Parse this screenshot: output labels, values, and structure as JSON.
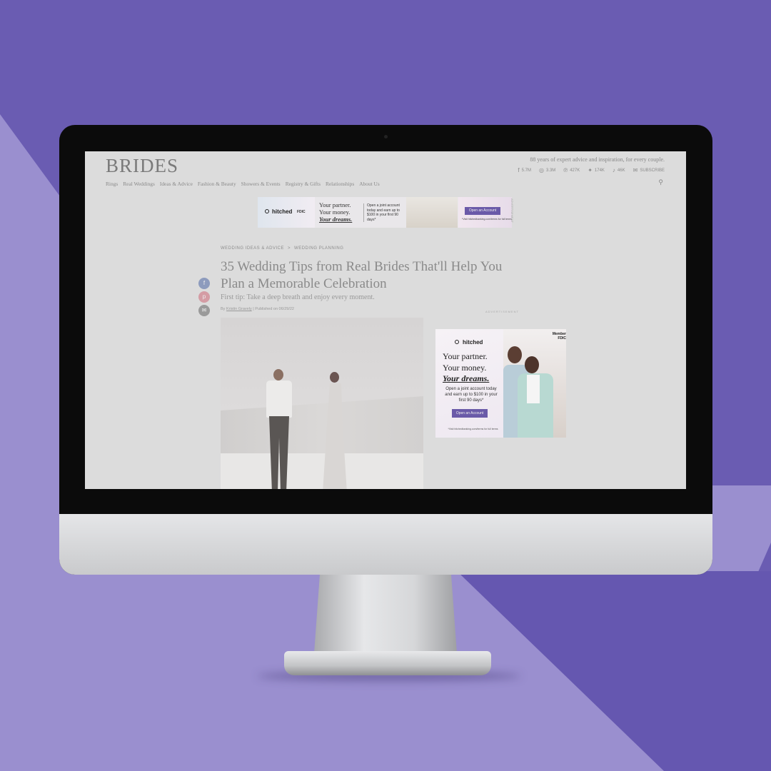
{
  "colors": {
    "background_dark": "#6a5cb2",
    "background_light": "#9a8fcf",
    "screen_bg": "#dcdcdc",
    "ad_cta": "#6a5aa8",
    "share_facebook": "#8d9bbd",
    "share_pinterest": "#d49ca4",
    "share_email": "#9a9a9a"
  },
  "site": {
    "logo": "BRIDES",
    "tagline": "88 years of expert advice and inspiration, for every couple.",
    "socials": [
      {
        "icon": "facebook-icon",
        "glyph": "f",
        "count": "5.7M"
      },
      {
        "icon": "instagram-icon",
        "glyph": "◎",
        "count": "3.3M"
      },
      {
        "icon": "pinterest-icon",
        "glyph": "℗",
        "count": "427K"
      },
      {
        "icon": "twitter-icon",
        "glyph": "✦",
        "count": "174K"
      },
      {
        "icon": "tiktok-icon",
        "glyph": "♪",
        "count": "46K"
      },
      {
        "icon": "mail-icon",
        "glyph": "✉",
        "count": "SUBSCRIBE"
      }
    ],
    "nav": [
      "Rings",
      "Real Weddings",
      "Ideas & Advice",
      "Fashion & Beauty",
      "Showers & Events",
      "Registry & Gifts",
      "Relationships",
      "About Us"
    ],
    "search_icon": "search-icon"
  },
  "top_ad": {
    "brand": "hitched",
    "fdic": "FDIC",
    "headline_1": "Your partner.",
    "headline_2": "Your money.",
    "headline_3": "Your dreams.",
    "body": "Open a joint account today and earn up to $100 in your first 90 days*",
    "cta": "Open an Account",
    "fine_print": "*Visit hitchedbanking.com/terms for full terms",
    "side_label": "ADVERTISEMENT"
  },
  "article": {
    "breadcrumb": [
      "WEDDING IDEAS & ADVICE",
      "WEDDING PLANNING"
    ],
    "breadcrumb_sep": ">",
    "title": "35 Wedding Tips from Real Brides That'll Help You Plan a Memorable Celebration",
    "subtitle": "First tip: Take a deep breath and enjoy every moment.",
    "byline_prefix": "By",
    "author": "Kristin Gravely",
    "published": "Published on 06/29/22",
    "ad_label": "ADVERTISEMENT"
  },
  "share": {
    "facebook": "f",
    "pinterest": "p",
    "email": "✉"
  },
  "side_ad": {
    "brand": "hitched",
    "fdic": "Member FDIC",
    "headline_1": "Your partner.",
    "headline_2": "Your money.",
    "headline_3": "Your dreams.",
    "body": "Open a joint account today and earn up to $100 in your first 90 days*",
    "cta": "Open an Account",
    "fine_print": "*Visit hitchedbanking.com/terms for full terms"
  }
}
